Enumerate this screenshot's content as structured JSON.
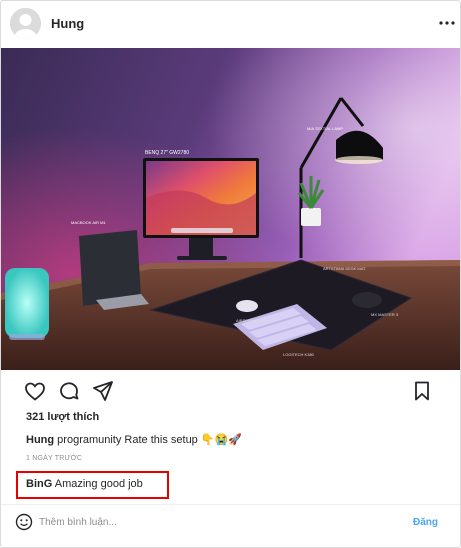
{
  "post": {
    "username": "Hung",
    "likes_text": "321 lượt thích",
    "caption": {
      "author": "Hung",
      "text": "programunity Rate this setup 👇😭🚀"
    },
    "timestamp": "1 NGÀY TRƯỚC"
  },
  "photo_labels": {
    "monitor": "BENQ 27\" GW2780",
    "lamp": "MIA TEXTIAL LAMP",
    "laptop": "MACBOOK AIR M1",
    "mouse": "AIRSPORT PRO",
    "keyboard": "LOGITECH K380",
    "pad": "MX MASTER 3",
    "deskmat": "ARTSTIMAI DESK MAT"
  },
  "comment": {
    "author": "BinG",
    "text": "Amazing good job"
  },
  "add_comment": {
    "placeholder": "Thêm bình luận...",
    "post_label": "Đăng"
  },
  "colors": {
    "accent": "#4aa3f5",
    "highlight_border": "#e60000",
    "muted": "#8e8e8e"
  },
  "icons": [
    "more-options-icon",
    "heart-icon",
    "comment-icon",
    "share-icon",
    "bookmark-icon",
    "emoji-icon"
  ]
}
